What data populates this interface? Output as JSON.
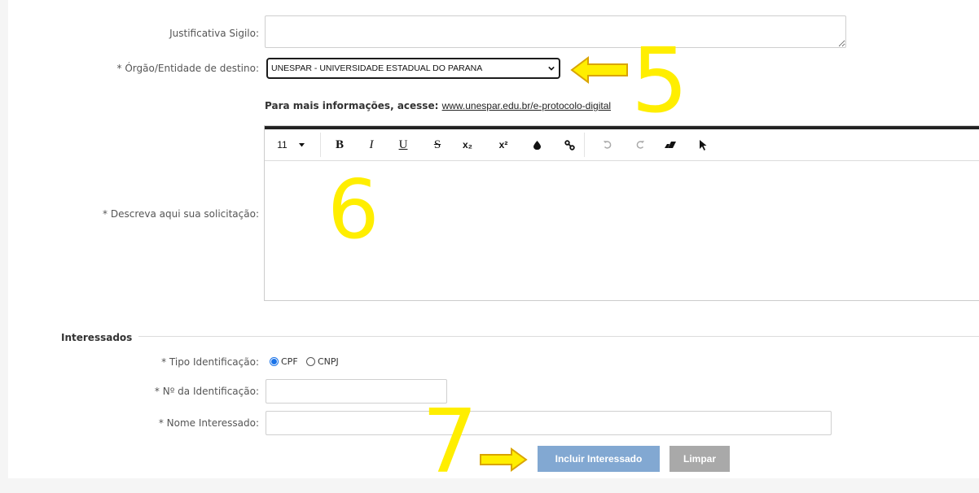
{
  "form": {
    "justificativa_label": "Justificativa Sigilo:",
    "orgao_label": "* Órgão/Entidade de destino:",
    "orgao_value": "UNESPAR - UNIVERSIDADE ESTADUAL DO PARANA",
    "info_text": "Para mais informações, acesse: ",
    "info_link": "www.unespar.edu.br/e-protocolo-digital",
    "descreva_label": "* Descreva aqui sua solicitação:"
  },
  "editor": {
    "font_size": "11",
    "superscript_label": "x²",
    "subscript_label": "x₂"
  },
  "interessados": {
    "legend": "Interessados",
    "tipo_label": "* Tipo Identificação:",
    "cpf_label": "CPF",
    "cnpj_label": "CNPJ",
    "numero_label": "* Nº da Identificação:",
    "nome_label": "* Nome Interessado:",
    "incluir_button": "Incluir Interessado",
    "limpar_button": "Limpar"
  },
  "annotations": {
    "step5": "5",
    "step6": "6",
    "step7": "7",
    "color": "#ffee00"
  },
  "colors": {
    "primary_button": "#82a8d2",
    "secondary_button": "#a9a9a9",
    "radio_accent": "#1a73e8"
  }
}
